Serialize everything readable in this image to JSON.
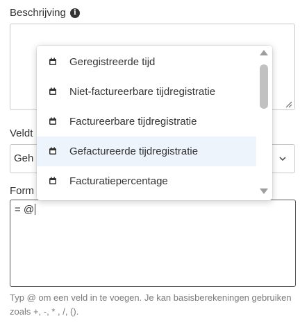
{
  "description": {
    "label": "Beschrijving",
    "value": ""
  },
  "field_type": {
    "label": "Veldt",
    "value": "Geh"
  },
  "formula": {
    "label": "Form",
    "value": "= @",
    "helper": "Typ @ om een veld in te voegen. Je kan basisberekeningen gebruiken zoals +, -, * , /, ()."
  },
  "dropdown": {
    "items": [
      {
        "label": "Geregistreerde tijd",
        "icon": "calendar-icon"
      },
      {
        "label": "Niet-factureerbare tijdregistratie",
        "icon": "calendar-icon"
      },
      {
        "label": "Factureerbare tijdregistratie",
        "icon": "calendar-icon"
      },
      {
        "label": "Gefactureerde tijdregistratie",
        "icon": "calendar-icon",
        "highlighted": true
      },
      {
        "label": "Facturatiepercentage",
        "icon": "calendar-icon"
      }
    ]
  },
  "colors": {
    "highlight": "#eef4fb",
    "text": "#333333",
    "helper": "#7a7a7a",
    "border": "#c8c8c8"
  }
}
